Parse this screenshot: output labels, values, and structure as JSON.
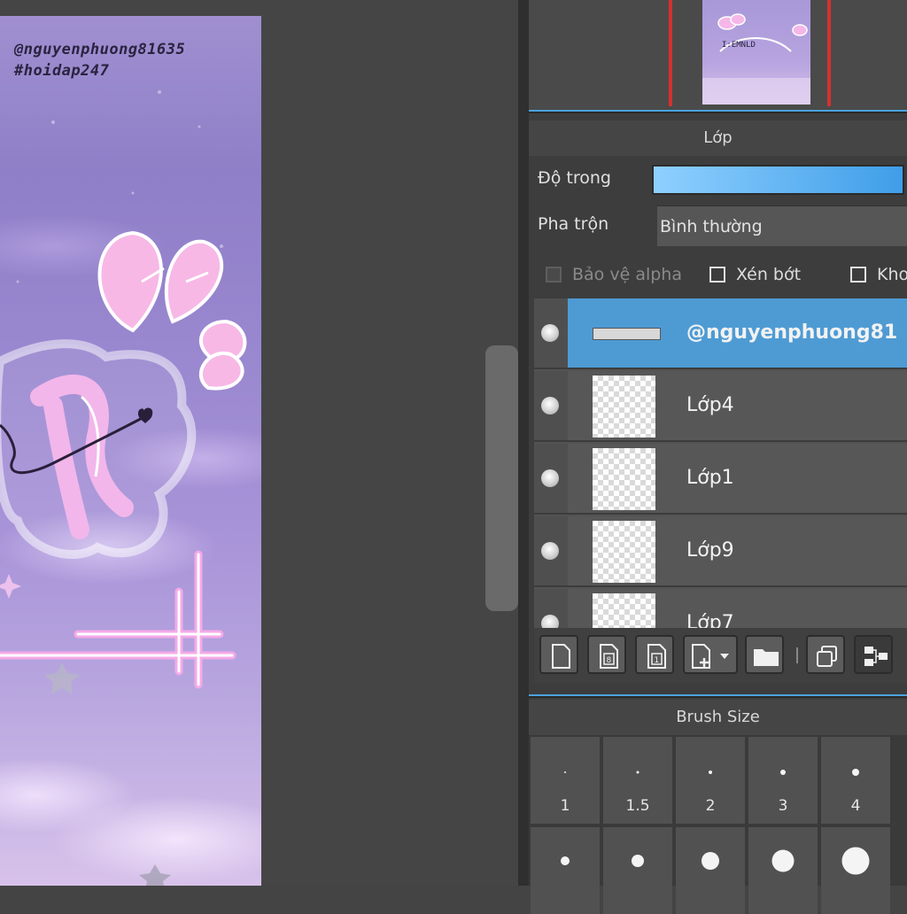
{
  "canvas": {
    "caption_lines": [
      "@nguyenphuong81635",
      "#hoidap247"
    ]
  },
  "layer_panel": {
    "title": "Lớp",
    "opacity_label": "Độ trong",
    "blend_label": "Pha trộn",
    "blend_value": "Bình thường",
    "checkboxes": [
      {
        "label": "Bảo vệ alpha",
        "checked": false,
        "enabled": false
      },
      {
        "label": "Xén bớt",
        "checked": false,
        "enabled": true
      },
      {
        "label": "Kho",
        "checked": false,
        "enabled": true
      }
    ],
    "layers": [
      {
        "name": "@nguyenphuong81",
        "selected": true
      },
      {
        "name": "Lớp4",
        "selected": false
      },
      {
        "name": "Lớp1",
        "selected": false
      },
      {
        "name": "Lớp9",
        "selected": false
      },
      {
        "name": "Lớp7",
        "selected": false
      }
    ],
    "toolbar_icons": [
      "new-layer-icon",
      "new-8bit-layer-icon",
      "new-1bit-layer-icon",
      "add-layer-menu-icon",
      "folder-icon",
      "duplicate-layer-icon",
      "merge-down-icon"
    ]
  },
  "brush_size": {
    "title": "Brush Size",
    "sizes": [
      "1",
      "1.5",
      "2",
      "3",
      "4"
    ]
  },
  "colors": {
    "accent": "#4aa3df",
    "selected_layer": "#4e9bd4",
    "navigator_frame": "#d63030"
  }
}
